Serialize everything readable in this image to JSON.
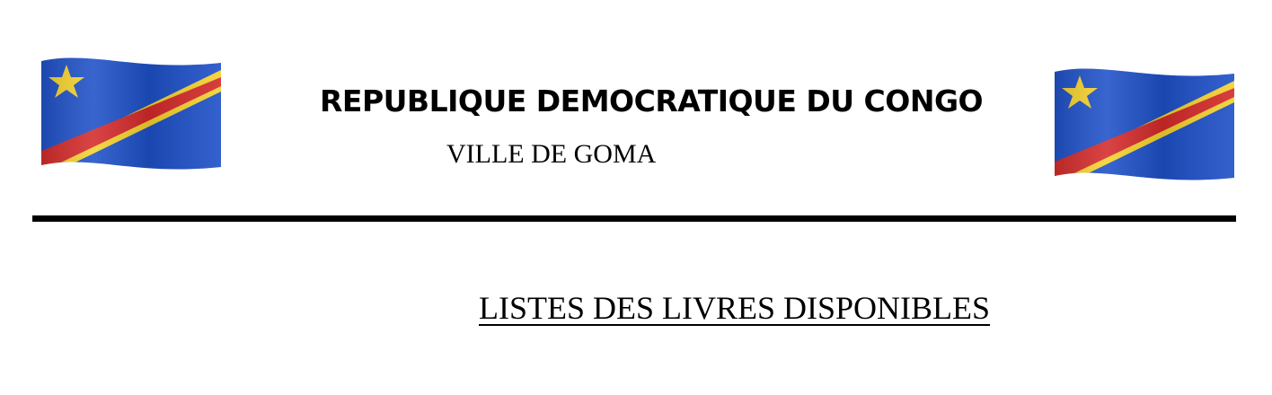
{
  "header": {
    "country": "REPUBLIQUE DEMOCRATIQUE DU CONGO",
    "city": "VILLE DE GOMA",
    "flag_icon": "flag-drc-icon"
  },
  "document": {
    "title": "LISTES DES LIVRES DISPONIBLES"
  },
  "colors": {
    "flag_blue": "#1e50c8",
    "flag_red": "#d42a2a",
    "flag_yellow": "#f5d22e",
    "rule": "#000000"
  }
}
